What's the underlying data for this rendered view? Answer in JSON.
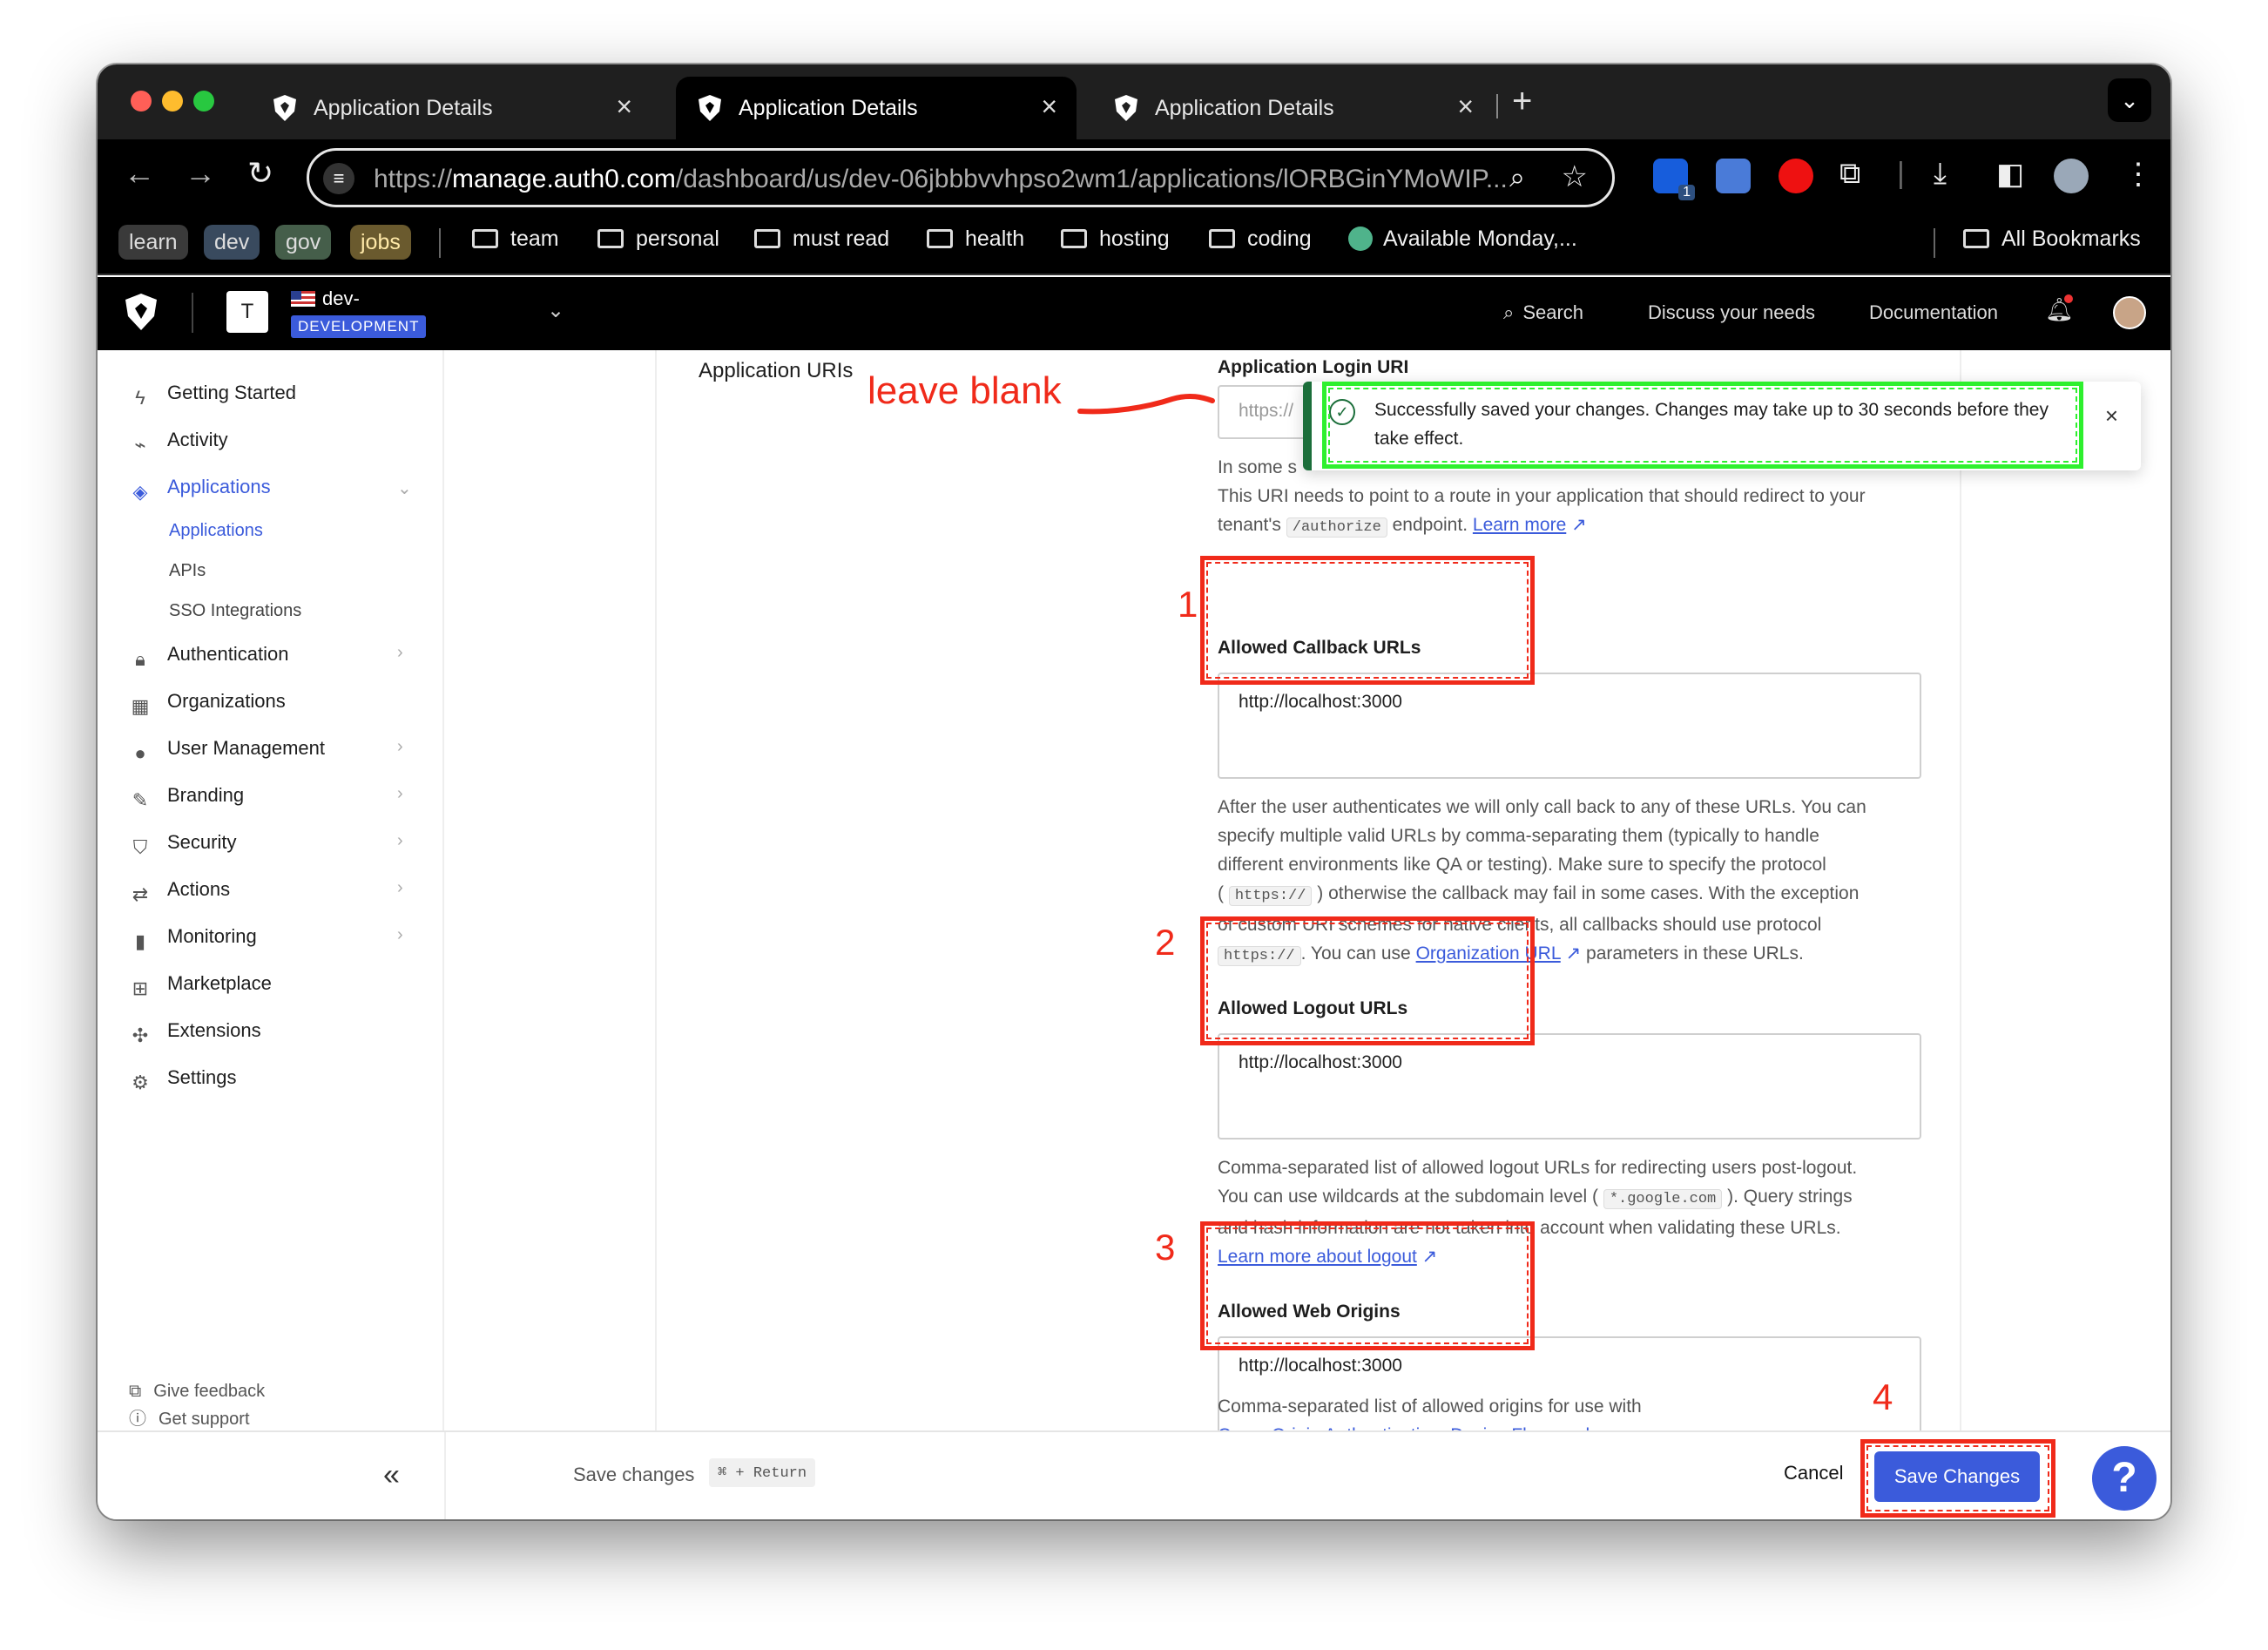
{
  "browser": {
    "tabs": [
      {
        "title": "Application Details",
        "active": false
      },
      {
        "title": "Application Details",
        "active": true
      },
      {
        "title": "Application Details",
        "active": false
      }
    ],
    "url_prefix": "https://",
    "url_host": "manage.auth0.com",
    "url_path": "/dashboard/us/dev-06jbbbvvhpso2wm1/applications/lORBGinYMoWIP...",
    "extension_badge": "1",
    "bookmarks": {
      "chips": [
        "learn",
        "dev",
        "gov",
        "jobs"
      ],
      "folders": [
        "team",
        "personal",
        "must read",
        "health",
        "hosting",
        "coding"
      ],
      "item": "Available Monday,...",
      "all": "All Bookmarks"
    }
  },
  "app_header": {
    "tenant_initial": "T",
    "tenant_name": "dev-",
    "environment": "DEVELOPMENT",
    "search": "Search",
    "discuss": "Discuss your needs",
    "documentation": "Documentation"
  },
  "sidebar": {
    "items": [
      {
        "label": "Getting Started",
        "icon": "bolt-icon"
      },
      {
        "label": "Activity",
        "icon": "activity-icon"
      },
      {
        "label": "Applications",
        "icon": "layers-icon"
      },
      {
        "label": "Authentication",
        "icon": "lock-icon"
      },
      {
        "label": "Organizations",
        "icon": "building-icon"
      },
      {
        "label": "User Management",
        "icon": "users-icon"
      },
      {
        "label": "Branding",
        "icon": "brush-icon"
      },
      {
        "label": "Security",
        "icon": "shield-icon"
      },
      {
        "label": "Actions",
        "icon": "actions-icon"
      },
      {
        "label": "Monitoring",
        "icon": "bar-chart-icon"
      },
      {
        "label": "Marketplace",
        "icon": "grid-plus-icon"
      },
      {
        "label": "Extensions",
        "icon": "puzzle-icon"
      },
      {
        "label": "Settings",
        "icon": "gear-icon"
      }
    ],
    "subitems": [
      "Applications",
      "APIs",
      "SSO Integrations"
    ],
    "footer": [
      "Get support",
      "Give feedback"
    ]
  },
  "content": {
    "section_title": "Application URIs",
    "login_uri_label": "Application Login URI",
    "login_uri_placeholder": "https://",
    "login_help_1": "In some s",
    "login_help_2": "This URI needs to point to a route in your application that should redirect to your",
    "login_help_3a": "tenant's",
    "login_help_code": "/authorize",
    "login_help_3b": "endpoint.",
    "login_help_link": "Learn more",
    "callback_label": "Allowed Callback URLs",
    "callback_value": "http://localhost:3000",
    "callback_help_1": "After the user authenticates we will only call back to any of these URLs. You can",
    "callback_help_2": "specify multiple valid URLs by comma-separating them (typically to handle",
    "callback_help_3": "different environments like QA or testing). Make sure to specify the protocol",
    "callback_help_code": "https://",
    "callback_help_4": ") otherwise the callback may fail in some cases. With the exception",
    "callback_help_5": "of custom URI schemes for native clients, all callbacks should use protocol",
    "callback_help_6a": ". You can use",
    "callback_help_link": "Organization URL",
    "callback_help_6b": "parameters in these URLs.",
    "logout_label": "Allowed Logout URLs",
    "logout_value": "http://localhost:3000",
    "logout_help_1": "Comma-separated list of allowed logout URLs for redirecting users post-logout.",
    "logout_help_2a": "You can use wildcards at the subdomain level (",
    "logout_help_code": "*.google.com",
    "logout_help_2b": "). Query strings",
    "logout_help_3": "and hash information are not taken into account when validating these URLs.",
    "logout_help_link": "Learn more about logout",
    "origins_label": "Allowed Web Origins",
    "origins_value": "http://localhost:3000",
    "origins_help_1": "Comma-separated list of allowed origins for use with",
    "origins_help_2": "Cross-Origin Authentication,  Device Flow,  and"
  },
  "toast": {
    "message": "Successfully saved your changes. Changes may take up to 30 seconds before they take effect."
  },
  "annotations": {
    "leave_blank": "leave blank",
    "numbers": [
      "1",
      "2",
      "3",
      "4"
    ],
    "color": "#f02a1a",
    "highlight_color": "#2ef02e"
  },
  "bottom_bar": {
    "save_hint": "Save changes",
    "shortcut": "⌘ + Return",
    "cancel": "Cancel",
    "save": "Save Changes",
    "help": "?"
  },
  "colors": {
    "accent": "#3b5bdb",
    "success": "#1b6e3a"
  }
}
